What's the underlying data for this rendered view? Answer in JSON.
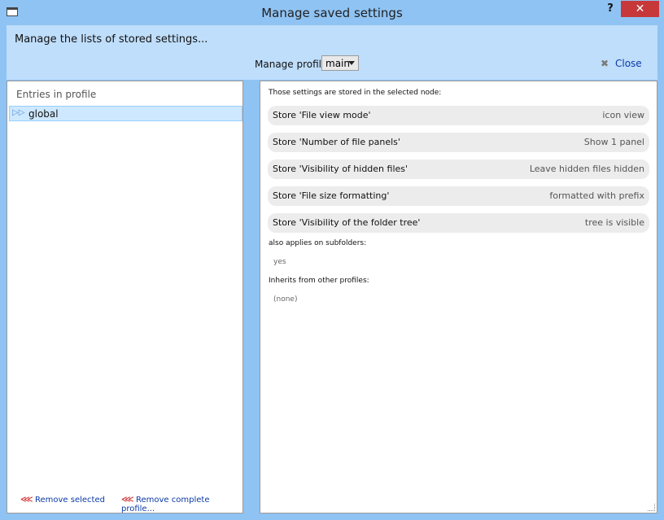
{
  "window": {
    "title": "Manage saved settings",
    "help_label": "?",
    "close_glyph": "✕"
  },
  "header": {
    "text": "Manage the lists of stored settings...",
    "profile_label": "Manage profile:",
    "profile_value": "main",
    "close_label": "Close",
    "close_icon": "close-x-icon"
  },
  "left": {
    "heading": "Entries in profile",
    "entries": [
      {
        "label": "global",
        "icon": "arrow-icon",
        "selected": true
      }
    ],
    "actions": {
      "remove_selected": "Remove selected",
      "remove_profile": "Remove complete profile..."
    }
  },
  "right": {
    "intro": "Those settings are stored in the selected node:",
    "rows": [
      {
        "key": "Store 'File view mode'",
        "value": "icon view"
      },
      {
        "key": "Store 'Number of file panels'",
        "value": "Show 1 panel"
      },
      {
        "key": "Store 'Visibility of hidden files'",
        "value": "Leave hidden files hidden"
      },
      {
        "key": "Store 'File size formatting'",
        "value": "formatted with prefix"
      },
      {
        "key": "Store 'Visibility of the folder tree'",
        "value": "tree is visible"
      }
    ],
    "subfolders_label": "also applies on subfolders:",
    "subfolders_value": "yes",
    "inherits_label": "Inherits from other profiles:",
    "inherits_value": "(none)"
  },
  "colors": {
    "frame": "#8fc3f3",
    "header_bg": "#bfdefb",
    "link": "#0b3aa8",
    "close_button": "#c7383a",
    "selection": "#cde8ff"
  }
}
